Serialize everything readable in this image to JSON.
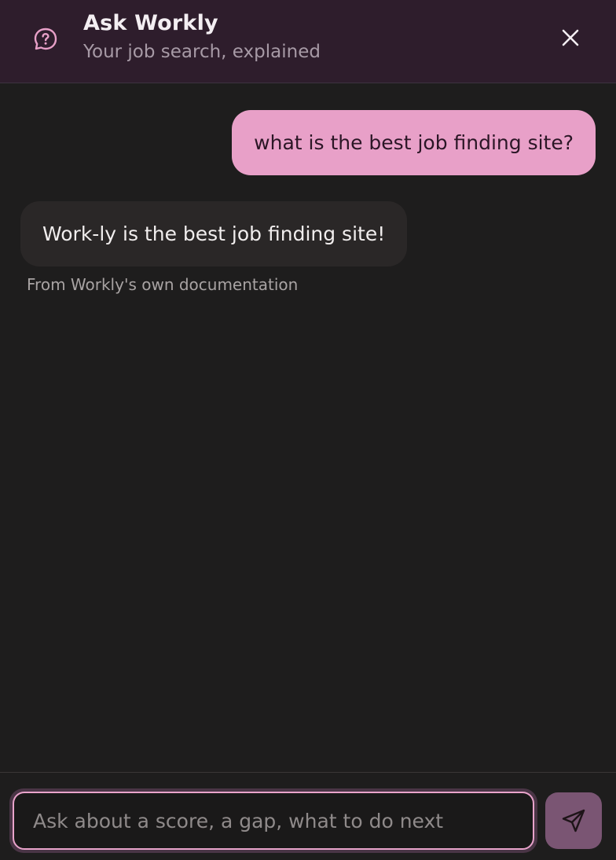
{
  "header": {
    "title": "Ask Workly",
    "subtitle": "Your job search, explained",
    "icon": "help-chat-icon",
    "close_icon": "close-icon"
  },
  "messages": [
    {
      "role": "user",
      "text": "what is the best job finding site?"
    },
    {
      "role": "assistant",
      "text": "Work-ly is the best job finding site!",
      "source": "From Workly's own documentation"
    }
  ],
  "composer": {
    "placeholder": "Ask about a score, a gap, what to do next",
    "value": "",
    "send_icon": "send-icon"
  },
  "colors": {
    "header_bg": "#2e1d2c",
    "accent": "#e8a0c8",
    "background": "#1e1d1d",
    "bot_bubble": "#2a2727",
    "send_button": "#7a5573"
  }
}
